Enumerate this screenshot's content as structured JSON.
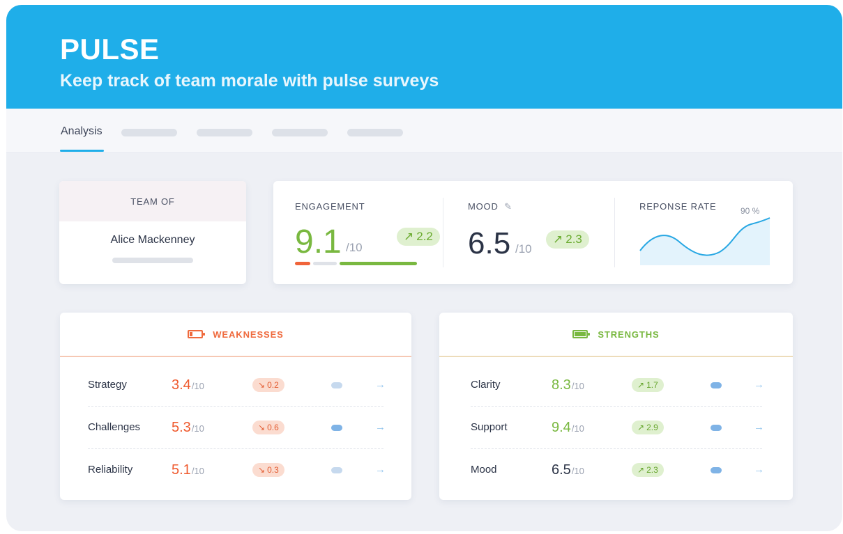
{
  "header": {
    "title": "PULSE",
    "subtitle": "Keep track of team morale with pulse surveys"
  },
  "tabs": {
    "active_label": "Analysis"
  },
  "team": {
    "label": "TEAM OF",
    "name": "Alice Mackenney"
  },
  "stats": {
    "engagement": {
      "label": "ENGAGEMENT",
      "value": "9.1",
      "out_of": "/10",
      "change": "2.2"
    },
    "mood": {
      "label": "MOOD",
      "value": "6.5",
      "out_of": "/10",
      "change": "2.3"
    },
    "response_rate": {
      "label": "REPONSE RATE",
      "value_label": "90 %"
    }
  },
  "weaknesses": {
    "title": "WEAKNESSES",
    "rows": [
      {
        "name": "Strategy",
        "score": "3.4",
        "out_of": "/10",
        "change": "0.2"
      },
      {
        "name": "Challenges",
        "score": "5.3",
        "out_of": "/10",
        "change": "0.6"
      },
      {
        "name": "Reliability",
        "score": "5.1",
        "out_of": "/10",
        "change": "0.3"
      }
    ]
  },
  "strengths": {
    "title": "STRENGTHS",
    "rows": [
      {
        "name": "Clarity",
        "score": "8.3",
        "out_of": "/10",
        "change": "1.7"
      },
      {
        "name": "Support",
        "score": "9.4",
        "out_of": "/10",
        "change": "2.9"
      },
      {
        "name": "Mood",
        "score": "6.5",
        "out_of": "/10",
        "change": "2.3"
      }
    ]
  },
  "colors": {
    "brand": "#1faee9",
    "positive": "#79b840",
    "negative": "#ef5a2e"
  }
}
